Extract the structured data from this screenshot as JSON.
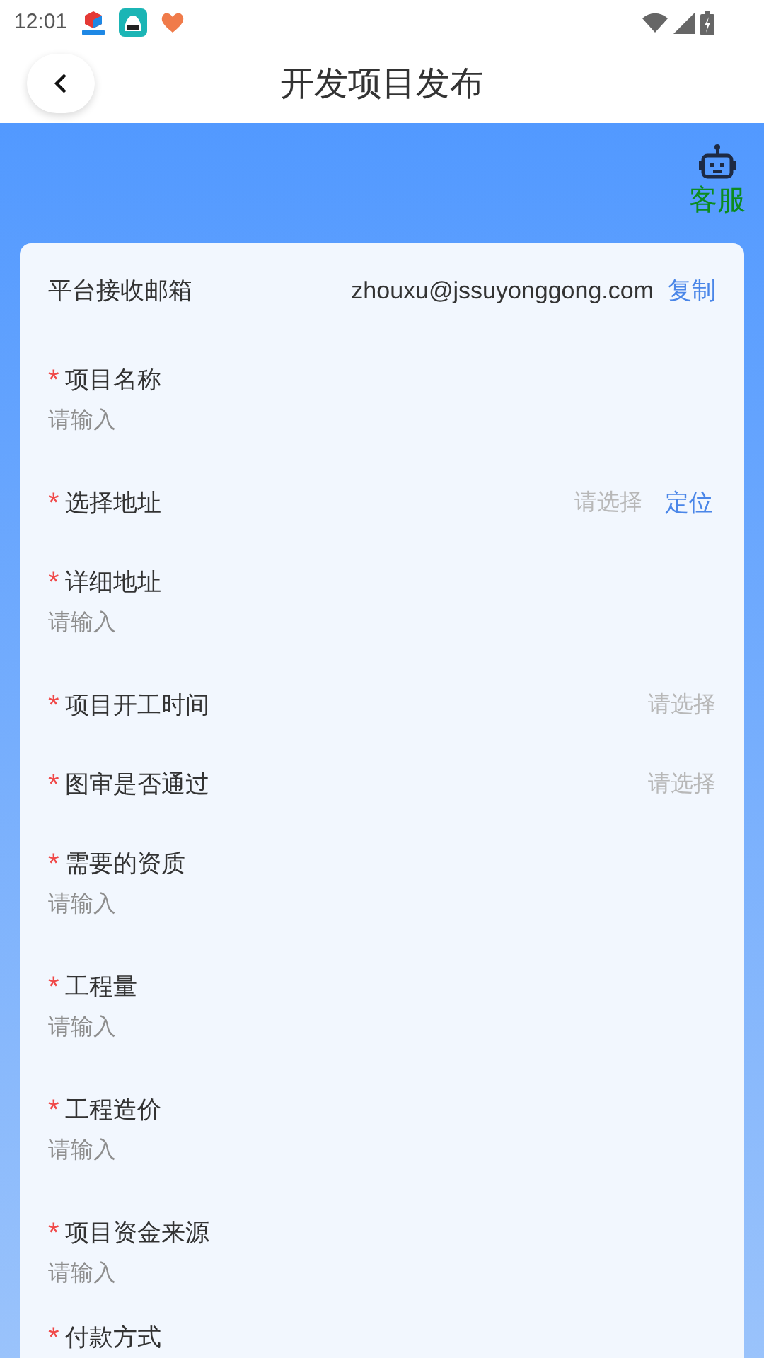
{
  "status_bar": {
    "time": "12:01"
  },
  "header": {
    "title": "开发项目发布"
  },
  "service": {
    "label": "客服"
  },
  "email_row": {
    "label": "平台接收邮箱",
    "value": "zhouxu@jssuyonggong.com",
    "action": "复制"
  },
  "fields": [
    {
      "kind": "input",
      "required_mark": "*",
      "label": "项目名称",
      "placeholder": "请输入"
    },
    {
      "kind": "select",
      "required_mark": "*",
      "label": "选择地址",
      "placeholder": "请选择",
      "action": "定位"
    },
    {
      "kind": "input",
      "required_mark": "*",
      "label": "详细地址",
      "placeholder": "请输入"
    },
    {
      "kind": "select",
      "required_mark": "*",
      "label": "项目开工时间",
      "placeholder": "请选择"
    },
    {
      "kind": "select",
      "required_mark": "*",
      "label": "图审是否通过",
      "placeholder": "请选择"
    },
    {
      "kind": "input",
      "required_mark": "*",
      "label": "需要的资质",
      "placeholder": "请输入"
    },
    {
      "kind": "input",
      "required_mark": "*",
      "label": "工程量",
      "placeholder": "请输入"
    },
    {
      "kind": "input",
      "required_mark": "*",
      "label": "工程造价",
      "placeholder": "请输入"
    },
    {
      "kind": "input",
      "required_mark": "*",
      "label": "项目资金来源",
      "placeholder": "请输入"
    },
    {
      "kind": "label",
      "required_mark": "*",
      "label": "付款方式"
    }
  ]
}
